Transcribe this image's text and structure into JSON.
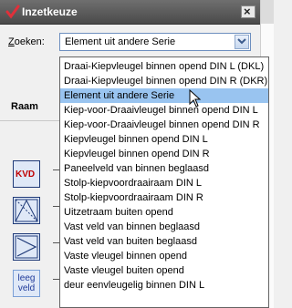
{
  "window": {
    "title": "Inzetkeuze",
    "close_symbol": "×"
  },
  "search": {
    "label_prefix": "Z",
    "label_rest": "oeken:",
    "value": "Element uit andere Serie"
  },
  "section": {
    "label": "Raam"
  },
  "thumbnails": [
    {
      "name": "kvd-thumbnail",
      "text": "KVD"
    },
    {
      "name": "kiep-thumbnail",
      "text": ""
    },
    {
      "name": "draai-thumbnail",
      "text": ""
    },
    {
      "name": "leeg-veld-thumbnail",
      "line1": "leeg",
      "line2": "veld"
    }
  ],
  "dropdown": {
    "selected_index": 2,
    "options": [
      "Draai-Kiepvleugel binnen opend  DIN L (DKL)",
      "Draai-Kiepvleugel binnen opend  DIN R (DKR)",
      "Element uit andere Serie",
      "Kiep-voor-Draaivleugel binnen opend  DIN L",
      "Kiep-voor-Draaivleugel binnen opend  DIN R",
      "Kiepvleugel binnen opend  DIN L",
      "Kiepvleugel binnen opend  DIN R",
      "Paneelveld van binnen beglaasd",
      "Stolp-kiepvoordraairaam  DIN L",
      "Stolp-kiepvoordraairaam  DIN R",
      "Uitzetraam buiten opend",
      "Vast veld van binnen beglaasd",
      "Vast veld van buiten beglaasd",
      "Vaste vleugel binnen opend",
      "Vaste vleugel buiten opend",
      "deur eenvleugelig binnen  DIN L"
    ]
  },
  "colors": {
    "selection": "#99c4f0",
    "title_bar": "#555555",
    "kvd_text": "#c00000"
  }
}
